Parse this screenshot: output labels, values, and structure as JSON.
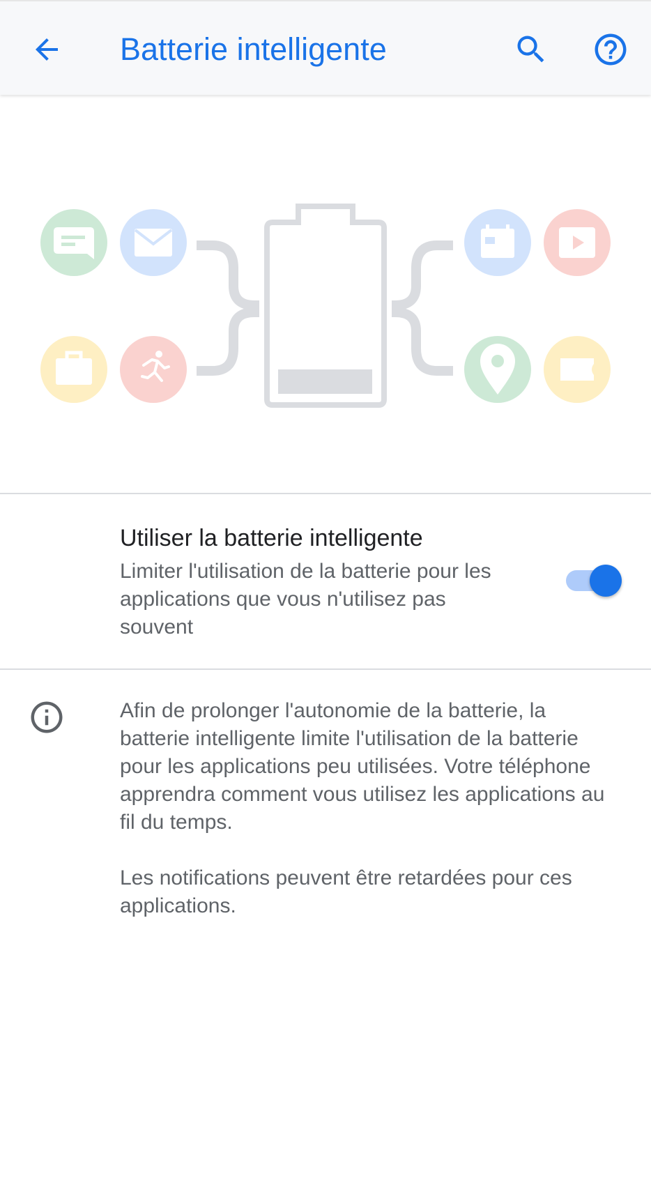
{
  "toolbar": {
    "title": "Batterie intelligente",
    "back_icon": "arrow-back-icon",
    "search_icon": "search-icon",
    "help_icon": "help-icon"
  },
  "illustration": {
    "app_icons": [
      "chat-icon",
      "mail-icon",
      "calendar-icon",
      "video-icon",
      "briefcase-icon",
      "fitness-icon",
      "map-pin-icon",
      "ticket-icon"
    ],
    "battery_icon": "battery-icon"
  },
  "setting": {
    "title": "Utiliser la batterie intelligente",
    "summary": "Limiter l'utilisation de la batterie pour les applications que vous n'utilisez pas souvent",
    "enabled": true
  },
  "info": {
    "icon": "info-icon",
    "paragraph1": "Afin de prolonger l'autonomie de la batterie, la batterie intelligente limite l'utilisation de la batterie pour les applications peu utilisées. Votre téléphone apprendra comment vous utilisez les applications au fil du temps.",
    "paragraph2": "Les notifications peuvent être retardées pour ces applications."
  },
  "colors": {
    "accent": "#1a73e8",
    "toolbar_bg": "#f7f8fa",
    "text_primary": "#202124",
    "text_secondary": "#5f6368"
  }
}
